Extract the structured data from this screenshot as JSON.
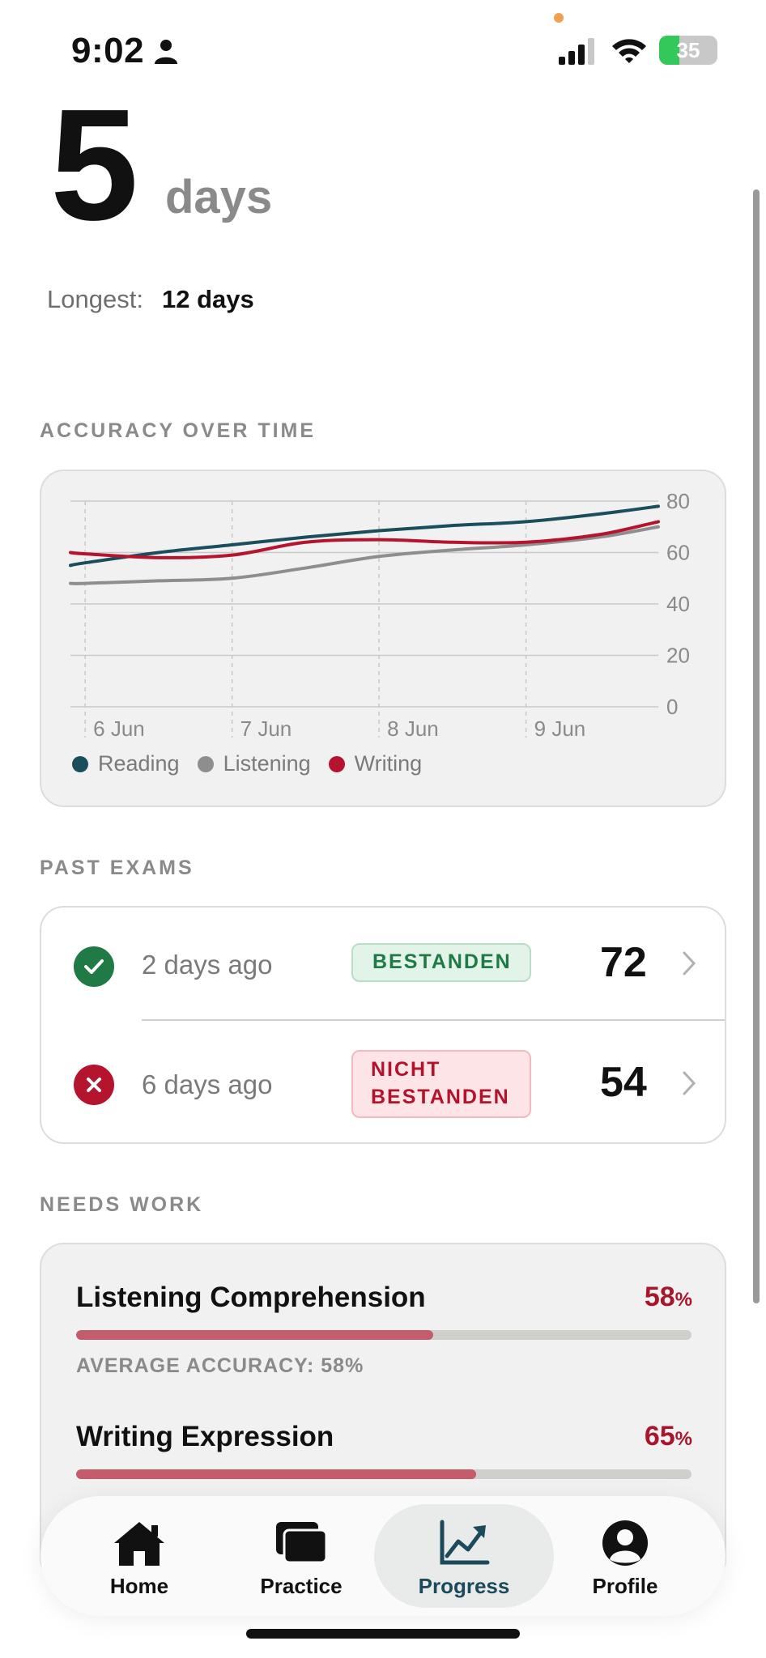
{
  "status_bar": {
    "time": "9:02",
    "battery": "35",
    "battery_level": 0.35
  },
  "streak": {
    "value": "5",
    "unit": "days",
    "longest_label": "Longest:",
    "longest_value": "12 days"
  },
  "accuracy": {
    "section_label": "ACCURACY OVER TIME",
    "legend": [
      {
        "name": "Reading",
        "color": "#1a4e5c"
      },
      {
        "name": "Listening",
        "color": "#8e8e8e"
      },
      {
        "name": "Writing",
        "color": "#b5142f"
      }
    ]
  },
  "chart_data": {
    "type": "line",
    "x": [
      5.9,
      6.0,
      6.5,
      7.0,
      7.5,
      8.0,
      8.5,
      9.0,
      9.5,
      9.9
    ],
    "categories": [
      "6 Jun",
      "7 Jun",
      "8 Jun",
      "9 Jun"
    ],
    "category_x": [
      6,
      7,
      8,
      9
    ],
    "xlim": [
      5.9,
      9.9
    ],
    "ylim": [
      0,
      80
    ],
    "yticks": [
      0,
      20,
      40,
      60,
      80
    ],
    "series": [
      {
        "name": "Reading",
        "color": "#1a4e5c",
        "values": [
          55,
          56,
          60,
          63,
          66,
          68.5,
          70.5,
          72,
          75,
          78
        ]
      },
      {
        "name": "Listening",
        "color": "#8e8e8e",
        "values": [
          48,
          48,
          49,
          50,
          54,
          58.5,
          61,
          63,
          66,
          70
        ]
      },
      {
        "name": "Writing",
        "color": "#b5142f",
        "values": [
          60,
          59.5,
          58,
          59,
          64,
          65,
          64,
          64,
          67,
          72
        ]
      }
    ]
  },
  "past_exams": {
    "section_label": "PAST EXAMS",
    "items": [
      {
        "when": "2 days ago",
        "badge_line1": "BESTANDEN",
        "badge_line2": "",
        "score": "72",
        "passed": true
      },
      {
        "when": "6 days ago",
        "badge_line1": "NICHT",
        "badge_line2": "BESTANDEN",
        "score": "54",
        "passed": false
      }
    ]
  },
  "needs_work": {
    "section_label": "NEEDS WORK",
    "items": [
      {
        "name": "Listening Comprehension",
        "pct": "58",
        "pct_unit": "%",
        "progress": 0.58,
        "caption": "AVERAGE ACCURACY: 58%"
      },
      {
        "name": "Writing Expression",
        "pct": "65",
        "pct_unit": "%",
        "progress": 0.65,
        "caption": ""
      }
    ]
  },
  "nav": {
    "items": [
      {
        "label": "Home",
        "icon": "home-icon"
      },
      {
        "label": "Practice",
        "icon": "practice-icon"
      },
      {
        "label": "Progress",
        "icon": "progress-chart-icon",
        "active": true
      },
      {
        "label": "Profile",
        "icon": "profile-icon"
      }
    ]
  }
}
